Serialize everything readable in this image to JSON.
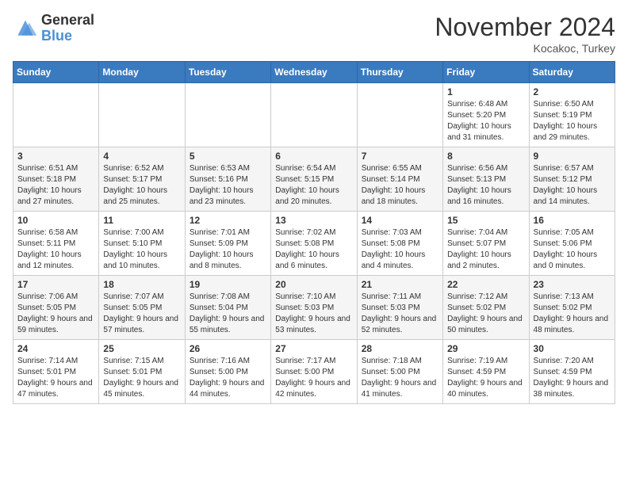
{
  "header": {
    "logo_general": "General",
    "logo_blue": "Blue",
    "month_title": "November 2024",
    "location": "Kocakoc, Turkey"
  },
  "weekdays": [
    "Sunday",
    "Monday",
    "Tuesday",
    "Wednesday",
    "Thursday",
    "Friday",
    "Saturday"
  ],
  "weeks": [
    [
      {
        "day": "",
        "info": ""
      },
      {
        "day": "",
        "info": ""
      },
      {
        "day": "",
        "info": ""
      },
      {
        "day": "",
        "info": ""
      },
      {
        "day": "",
        "info": ""
      },
      {
        "day": "1",
        "info": "Sunrise: 6:48 AM\nSunset: 5:20 PM\nDaylight: 10 hours and 31 minutes."
      },
      {
        "day": "2",
        "info": "Sunrise: 6:50 AM\nSunset: 5:19 PM\nDaylight: 10 hours and 29 minutes."
      }
    ],
    [
      {
        "day": "3",
        "info": "Sunrise: 6:51 AM\nSunset: 5:18 PM\nDaylight: 10 hours and 27 minutes."
      },
      {
        "day": "4",
        "info": "Sunrise: 6:52 AM\nSunset: 5:17 PM\nDaylight: 10 hours and 25 minutes."
      },
      {
        "day": "5",
        "info": "Sunrise: 6:53 AM\nSunset: 5:16 PM\nDaylight: 10 hours and 23 minutes."
      },
      {
        "day": "6",
        "info": "Sunrise: 6:54 AM\nSunset: 5:15 PM\nDaylight: 10 hours and 20 minutes."
      },
      {
        "day": "7",
        "info": "Sunrise: 6:55 AM\nSunset: 5:14 PM\nDaylight: 10 hours and 18 minutes."
      },
      {
        "day": "8",
        "info": "Sunrise: 6:56 AM\nSunset: 5:13 PM\nDaylight: 10 hours and 16 minutes."
      },
      {
        "day": "9",
        "info": "Sunrise: 6:57 AM\nSunset: 5:12 PM\nDaylight: 10 hours and 14 minutes."
      }
    ],
    [
      {
        "day": "10",
        "info": "Sunrise: 6:58 AM\nSunset: 5:11 PM\nDaylight: 10 hours and 12 minutes."
      },
      {
        "day": "11",
        "info": "Sunrise: 7:00 AM\nSunset: 5:10 PM\nDaylight: 10 hours and 10 minutes."
      },
      {
        "day": "12",
        "info": "Sunrise: 7:01 AM\nSunset: 5:09 PM\nDaylight: 10 hours and 8 minutes."
      },
      {
        "day": "13",
        "info": "Sunrise: 7:02 AM\nSunset: 5:08 PM\nDaylight: 10 hours and 6 minutes."
      },
      {
        "day": "14",
        "info": "Sunrise: 7:03 AM\nSunset: 5:08 PM\nDaylight: 10 hours and 4 minutes."
      },
      {
        "day": "15",
        "info": "Sunrise: 7:04 AM\nSunset: 5:07 PM\nDaylight: 10 hours and 2 minutes."
      },
      {
        "day": "16",
        "info": "Sunrise: 7:05 AM\nSunset: 5:06 PM\nDaylight: 10 hours and 0 minutes."
      }
    ],
    [
      {
        "day": "17",
        "info": "Sunrise: 7:06 AM\nSunset: 5:05 PM\nDaylight: 9 hours and 59 minutes."
      },
      {
        "day": "18",
        "info": "Sunrise: 7:07 AM\nSunset: 5:05 PM\nDaylight: 9 hours and 57 minutes."
      },
      {
        "day": "19",
        "info": "Sunrise: 7:08 AM\nSunset: 5:04 PM\nDaylight: 9 hours and 55 minutes."
      },
      {
        "day": "20",
        "info": "Sunrise: 7:10 AM\nSunset: 5:03 PM\nDaylight: 9 hours and 53 minutes."
      },
      {
        "day": "21",
        "info": "Sunrise: 7:11 AM\nSunset: 5:03 PM\nDaylight: 9 hours and 52 minutes."
      },
      {
        "day": "22",
        "info": "Sunrise: 7:12 AM\nSunset: 5:02 PM\nDaylight: 9 hours and 50 minutes."
      },
      {
        "day": "23",
        "info": "Sunrise: 7:13 AM\nSunset: 5:02 PM\nDaylight: 9 hours and 48 minutes."
      }
    ],
    [
      {
        "day": "24",
        "info": "Sunrise: 7:14 AM\nSunset: 5:01 PM\nDaylight: 9 hours and 47 minutes."
      },
      {
        "day": "25",
        "info": "Sunrise: 7:15 AM\nSunset: 5:01 PM\nDaylight: 9 hours and 45 minutes."
      },
      {
        "day": "26",
        "info": "Sunrise: 7:16 AM\nSunset: 5:00 PM\nDaylight: 9 hours and 44 minutes."
      },
      {
        "day": "27",
        "info": "Sunrise: 7:17 AM\nSunset: 5:00 PM\nDaylight: 9 hours and 42 minutes."
      },
      {
        "day": "28",
        "info": "Sunrise: 7:18 AM\nSunset: 5:00 PM\nDaylight: 9 hours and 41 minutes."
      },
      {
        "day": "29",
        "info": "Sunrise: 7:19 AM\nSunset: 4:59 PM\nDaylight: 9 hours and 40 minutes."
      },
      {
        "day": "30",
        "info": "Sunrise: 7:20 AM\nSunset: 4:59 PM\nDaylight: 9 hours and 38 minutes."
      }
    ]
  ]
}
